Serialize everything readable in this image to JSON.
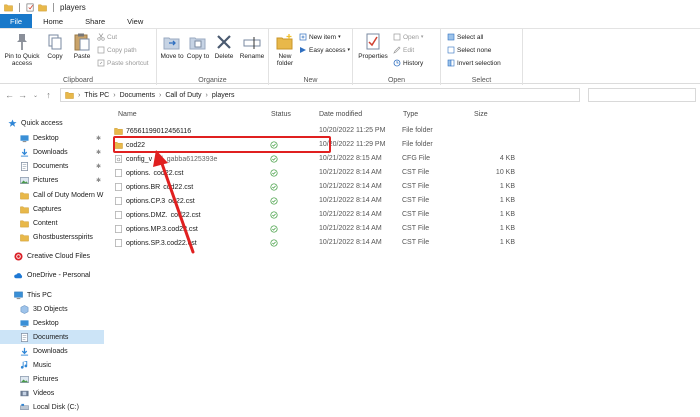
{
  "window": {
    "title": "players"
  },
  "tabs": [
    "File",
    "Home",
    "Share",
    "View"
  ],
  "ribbon": {
    "clipboard": {
      "name": "Clipboard",
      "pin_label": "Pin to Quick access",
      "copy_label": "Copy",
      "paste_label": "Paste",
      "cut_label": "Cut",
      "copy_path_label": "Copy path",
      "paste_shortcut_label": "Paste shortcut"
    },
    "organize": {
      "name": "Organize",
      "move_to_label": "Move to",
      "copy_to_label": "Copy to",
      "delete_label": "Delete",
      "rename_label": "Rename"
    },
    "new": {
      "name": "New",
      "new_folder_label": "New folder",
      "new_item_label": "New item",
      "easy_access_label": "Easy access"
    },
    "open": {
      "name": "Open",
      "properties_label": "Properties",
      "open_label": "Open",
      "edit_label": "Edit",
      "history_label": "History"
    },
    "select": {
      "name": "Select",
      "select_all_label": "Select all",
      "select_none_label": "Select none",
      "invert_label": "Invert selection"
    }
  },
  "address": {
    "crumbs": [
      "This PC",
      "Documents",
      "Call of Duty",
      "players"
    ]
  },
  "nav": {
    "quick_access": "Quick access",
    "items": [
      {
        "label": "Desktop",
        "pinned": true
      },
      {
        "label": "Downloads",
        "pinned": true
      },
      {
        "label": "Documents",
        "pinned": true
      },
      {
        "label": "Pictures",
        "pinned": true
      },
      {
        "label": "Call of Duty Modern W",
        "pinned": false
      },
      {
        "label": "Captures",
        "pinned": false
      },
      {
        "label": "Content",
        "pinned": false
      },
      {
        "label": "Ghostbustersspirits",
        "pinned": false
      }
    ],
    "creative_cloud": "Creative Cloud Files",
    "onedrive": "OneDrive - Personal",
    "this_pc": "This PC",
    "pc_items": [
      "3D Objects",
      "Desktop",
      "Documents",
      "Downloads",
      "Music",
      "Pictures",
      "Videos",
      "Local Disk (C:)"
    ]
  },
  "columns": {
    "name": "Name",
    "status": "Status",
    "date": "Date modified",
    "type": "Type",
    "size": "Size"
  },
  "files": [
    {
      "name": "76561199012456116",
      "date": "10/20/2022 11:25 PM",
      "type": "File folder",
      "size": "",
      "kind": "folder"
    },
    {
      "name": "cod22",
      "date": "10/20/2022 11:29 PM",
      "type": "File folder",
      "size": "",
      "kind": "folder"
    },
    {
      "name": "config_v",
      "name_hidden": "ed_gabba6125393e",
      "date": "10/21/2022 8:15 AM",
      "type": "CFG File",
      "size": "4 KB",
      "kind": "file"
    },
    {
      "name": "options.",
      "name_hidden": "cod22.cst",
      "date": "10/21/2022 8:14 AM",
      "type": "CST File",
      "size": "10 KB",
      "kind": "file"
    },
    {
      "name": "options.BR",
      "name_hidden": "cod22.cst",
      "date": "10/21/2022 8:14 AM",
      "type": "CST File",
      "size": "1 KB",
      "kind": "file"
    },
    {
      "name": "options.CP.3",
      "name_hidden": "od22.cst",
      "date": "10/21/2022 8:14 AM",
      "type": "CST File",
      "size": "1 KB",
      "kind": "file"
    },
    {
      "name": "options.DMZ.",
      "name_hidden": "cod22.cst",
      "date": "10/21/2022 8:14 AM",
      "type": "CST File",
      "size": "1 KB",
      "kind": "file"
    },
    {
      "name": "options.MP.3.cod22.cst",
      "name_hidden": "",
      "date": "10/21/2022 8:14 AM",
      "type": "CST File",
      "size": "1 KB",
      "kind": "file"
    },
    {
      "name": "options.SP.3.cod22.cst",
      "name_hidden": "",
      "date": "10/21/2022 8:14 AM",
      "type": "CST File",
      "size": "1 KB",
      "kind": "file"
    }
  ],
  "colors": {
    "file_tab": "#1979ca",
    "folder": "#e8b84a",
    "annotation": "#e02020",
    "selected": "#cce4f7"
  }
}
